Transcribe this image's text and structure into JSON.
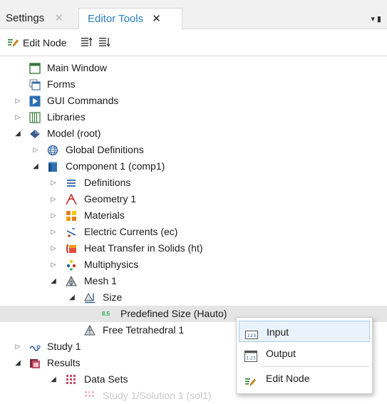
{
  "tabs": {
    "settings": {
      "label": "Settings",
      "close": "✕"
    },
    "editor_tools": {
      "label": "Editor Tools",
      "close": "✕"
    },
    "menu": "▾ ▮"
  },
  "toolbar": {
    "edit_node_label": "Edit Node"
  },
  "tree": [
    {
      "label": "Main Window",
      "icon": "main-window-icon",
      "caret": ""
    },
    {
      "label": "Forms",
      "icon": "forms-icon",
      "caret": ""
    },
    {
      "label": "GUI Commands",
      "icon": "gui-commands-icon",
      "caret": "▷"
    },
    {
      "label": "Libraries",
      "icon": "libraries-icon",
      "caret": "▷"
    },
    {
      "label": "Model (root)",
      "icon": "model-root-icon",
      "caret": "◢"
    },
    {
      "label": "Global Definitions",
      "icon": "globe-icon",
      "caret": "▷"
    },
    {
      "label": "Component 1 (comp1)",
      "icon": "component-icon",
      "caret": "◢"
    },
    {
      "label": "Definitions",
      "icon": "definitions-icon",
      "caret": "▷"
    },
    {
      "label": "Geometry 1",
      "icon": "geometry-icon",
      "caret": "▷"
    },
    {
      "label": "Materials",
      "icon": "materials-icon",
      "caret": "▷"
    },
    {
      "label": "Electric Currents (ec)",
      "icon": "electric-currents-icon",
      "caret": "▷"
    },
    {
      "label": "Heat Transfer in Solids (ht)",
      "icon": "heat-transfer-icon",
      "caret": "▷"
    },
    {
      "label": "Multiphysics",
      "icon": "multiphysics-icon",
      "caret": "▷"
    },
    {
      "label": "Mesh 1",
      "icon": "mesh-icon",
      "caret": "◢"
    },
    {
      "label": "Size",
      "icon": "size-icon",
      "caret": "◢"
    },
    {
      "label": "Predefined Size (Hauto)",
      "icon": "predefined-size-icon",
      "caret": "",
      "badge": "8.5"
    },
    {
      "label": "Free Tetrahedral 1",
      "icon": "free-tetrahedral-icon",
      "caret": ""
    },
    {
      "label": "Study 1",
      "icon": "study-icon",
      "caret": "▷"
    },
    {
      "label": "Results",
      "icon": "results-icon",
      "caret": "◢"
    },
    {
      "label": "Data Sets",
      "icon": "data-sets-icon",
      "caret": "◢"
    },
    {
      "label": "Study 1/Solution 1 (sol1)",
      "icon": "solution-icon",
      "caret": ""
    }
  ],
  "context_menu": {
    "items": [
      {
        "label": "Input",
        "icon": "input-icon",
        "badge": "123"
      },
      {
        "label": "Output",
        "icon": "output-icon",
        "badge": "1.23"
      },
      {
        "label": "Edit Node",
        "icon": "edit-node-icon"
      }
    ]
  },
  "colors": {
    "accent_blue": "#2a7fbf",
    "selected_row": "#e5e5e5",
    "hover_fill": "#eaf3fb",
    "hover_border": "#a8cfee"
  }
}
